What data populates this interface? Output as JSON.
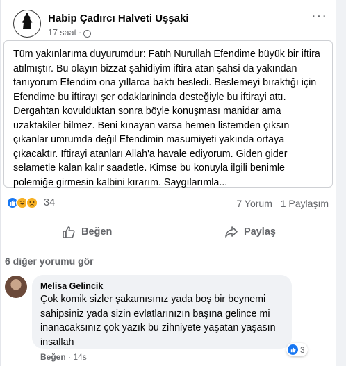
{
  "post": {
    "author": "Habip Çadırcı Halveti Uşşaki",
    "time": "17 saat",
    "separator": "·",
    "more_label": "···",
    "text": "Tüm yakınlarıma duyurumdur: Fatıh Nurullah Efendime büyük bir iftira atılmıştır. Bu olayın bizzat şahidiyim iftira atan şahsi da yakından tanıyorum Efendim ona yıllarca baktı besledi. Beslemeyi bıraktığı için Efendime bu iftirayı şer odaklarininda desteğiyle bu iftirayi attı. Dergahtan kovulduktan sonra böyle konuşması manidar ama uzaktakiler bilmez. Beni kınayan varsa hemen listemden çıksın çıkanlar umrumda değil Efendimin masumiyeti yakında ortaya çıkacaktır. Iftirayi atanları Allah'a havale ediyorum. Giden gider selametle kalan kalır saadetle. Kimse bu konuyla ilgili benimle polemiğe girmesin kalbini kırarım. Saygılarımla..."
  },
  "reactions": {
    "count": "34",
    "comments": "7 Yorum",
    "shares": "1 Paylaşım",
    "icons": [
      "like-icon",
      "haha-icon",
      "sad-icon"
    ],
    "like_color": "#1877f2"
  },
  "actions": {
    "like": "Beğen",
    "share": "Paylaş"
  },
  "comments": {
    "view_more": "6 diğer yorumu gör",
    "items": [
      {
        "author": "Melisa Gelincik",
        "text": "Çok komik sizler şakamısınız yada boş bir beynemi sahipsiniz yada sizin evlatlarınızın başına gelince mi inanacaksınız çok yazık bu zihniyete yaşatan yaşasın insallah",
        "reaction_count": "3",
        "like_label": "Beğen",
        "time": "14s"
      }
    ]
  }
}
